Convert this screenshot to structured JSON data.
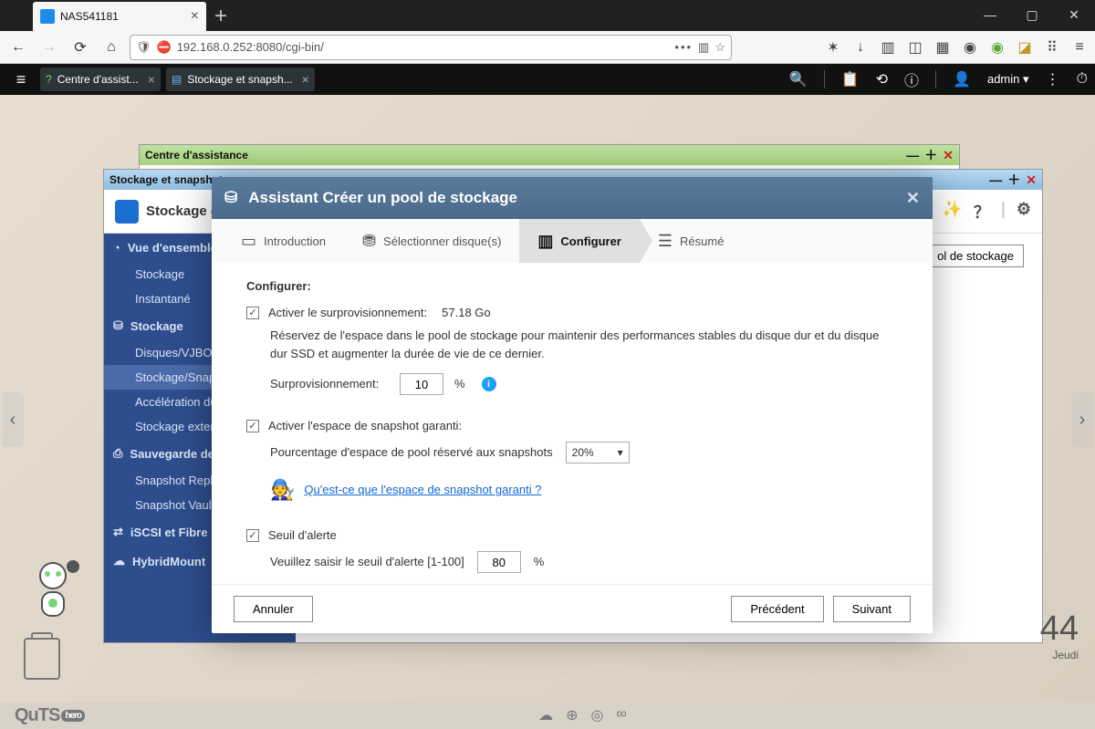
{
  "browser": {
    "tab_title": "NAS541181",
    "url": "192.168.0.252:8080/cgi-bin/"
  },
  "topbar": {
    "tabs": [
      {
        "label": "Centre d'assist...",
        "icon": "help-icon"
      },
      {
        "label": "Stockage et snapsh...",
        "icon": "storage-icon"
      }
    ],
    "user": "admin ▾"
  },
  "win_assist_title": "Centre d'assistance",
  "storage": {
    "win_title": "Stockage et snapshots",
    "header_title": "Stockage et snapshots",
    "create_button": "ol de stockage",
    "side_groups": [
      {
        "label": "Vue d'ensemble",
        "items": [
          "Stockage",
          "Instantané"
        ]
      },
      {
        "label": "Stockage",
        "items": [
          "Disques/VJBOD",
          "Stockage/Snapshots",
          "Accélération du cache",
          "Stockage externe"
        ]
      },
      {
        "label": "Sauvegarde de…",
        "items": [
          "Snapshot Replica",
          "Snapshot Vault"
        ]
      },
      {
        "label": "iSCSI et Fibre",
        "items": []
      },
      {
        "label": "HybridMount",
        "items": []
      }
    ]
  },
  "wizard": {
    "title": "Assistant Créer un pool de stockage",
    "steps": [
      "Introduction",
      "Sélectionner disque(s)",
      "Configurer",
      "Résumé"
    ],
    "active_step": 2,
    "section_title": "Configurer:",
    "overprov": {
      "checkbox_label": "Activer le surprovisionnement:",
      "size": "57.18 Go",
      "description": "Réservez de l'espace dans le pool de stockage pour maintenir des performances stables du disque dur et du disque dur SSD et augmenter la durée de vie de ce dernier.",
      "field_label": "Surprovisionnement:",
      "value": "10",
      "unit": "%"
    },
    "snapshot": {
      "checkbox_label": "Activer l'espace de snapshot garanti:",
      "field_label": "Pourcentage d'espace de pool réservé aux snapshots",
      "value": "20%",
      "help_link": "Qu'est-ce que l'espace de snapshot garanti ?"
    },
    "alert": {
      "checkbox_label": "Seuil d'alerte",
      "field_label": "Veuillez saisir le seuil d'alerte [1-100]",
      "value": "80",
      "unit": "%"
    },
    "buttons": {
      "cancel": "Annuler",
      "prev": "Précédent",
      "next": "Suivant"
    }
  },
  "clock": {
    "time": "44",
    "day": "Jeudi"
  },
  "footer_brand": "QuTS"
}
